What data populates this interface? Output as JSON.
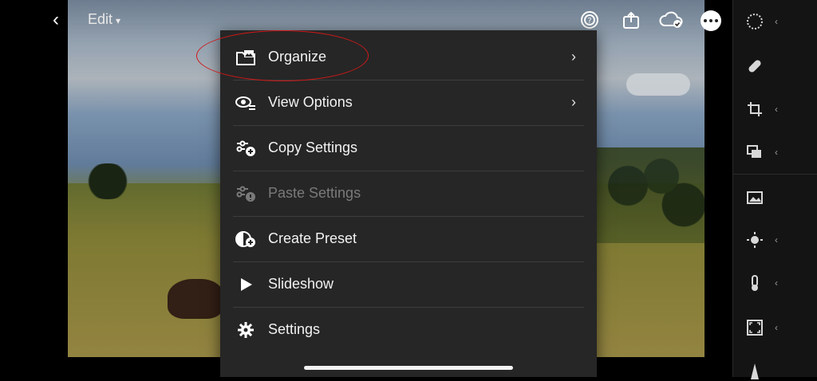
{
  "topbar": {
    "back_icon": "chevron-left-icon",
    "edit_label": "Edit",
    "icons": [
      "help-icon",
      "share-icon",
      "cloud-synced-icon",
      "more-icon"
    ]
  },
  "menu": {
    "items": [
      {
        "label": "Organize",
        "icon": "folder-image-icon",
        "submenu": true,
        "enabled": true
      },
      {
        "label": "View Options",
        "icon": "eye-list-icon",
        "submenu": true,
        "enabled": true
      },
      {
        "label": "Copy Settings",
        "icon": "copy-settings-icon",
        "submenu": false,
        "enabled": true
      },
      {
        "label": "Paste Settings",
        "icon": "paste-settings-icon",
        "submenu": false,
        "enabled": false
      },
      {
        "label": "Create Preset",
        "icon": "create-preset-icon",
        "submenu": false,
        "enabled": true
      },
      {
        "label": "Slideshow",
        "icon": "play-icon",
        "submenu": false,
        "enabled": true
      },
      {
        "label": "Settings",
        "icon": "gear-icon",
        "submenu": false,
        "enabled": true
      }
    ]
  },
  "right_toolbar": {
    "tools": [
      "presets-icon",
      "healing-icon",
      "crop-icon",
      "versions-icon",
      "auto-image-icon",
      "light-icon",
      "color-icon",
      "effects-frame-icon"
    ]
  },
  "colors": {
    "menu_bg": "#262626",
    "annotation": "#d01818",
    "text": "#f2f2f2",
    "disabled_text": "#7a7a7a"
  }
}
